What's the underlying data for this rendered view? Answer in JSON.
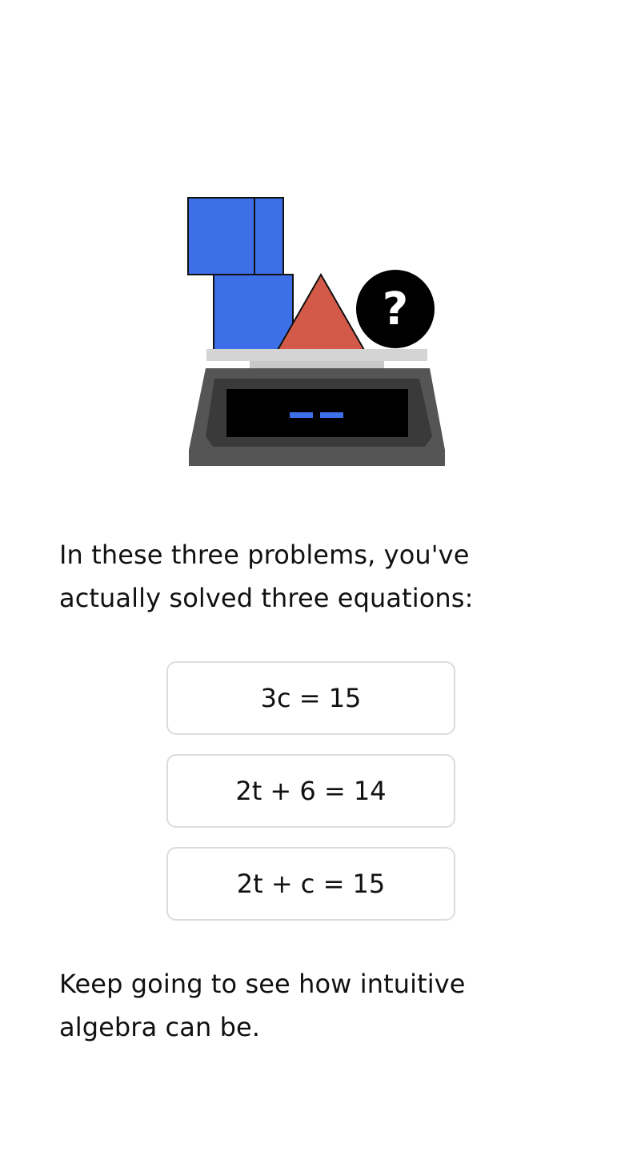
{
  "illustration": {
    "name": "balance-scale-with-shapes",
    "question_mark": "?",
    "colors": {
      "square": "#3d6fe8",
      "triangle": "#d35a48",
      "circle": "#000000",
      "scale_body": "#555555",
      "scale_inner": "#3a3a3a",
      "display": "#000000",
      "display_segments": "#3d6fe8",
      "platform": "#d4d4d4"
    }
  },
  "intro_text": "In these three problems, you've actually solved three equations:",
  "equations": [
    "3c = 15",
    "2t + 6 = 14",
    "2t + c = 15"
  ],
  "outro_text": "Keep going to see how intuitive algebra can be."
}
